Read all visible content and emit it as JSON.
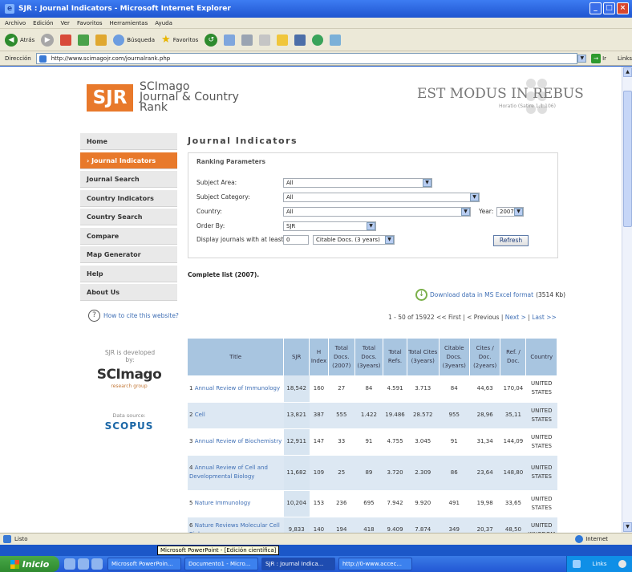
{
  "window": {
    "title": "SJR : Journal Indicators - Microsoft Internet Explorer"
  },
  "menu": [
    "Archivo",
    "Edición",
    "Ver",
    "Favoritos",
    "Herramientas",
    "Ayuda"
  ],
  "toolbar": {
    "back": "Atrás",
    "search": "Búsqueda",
    "favorites": "Favoritos"
  },
  "address": {
    "label": "Dirección",
    "url": "http://www.scimagojr.com/journalrank.php",
    "go_label": "Ir",
    "links": "Links"
  },
  "site": {
    "logo": "SJR",
    "logo_text": [
      "SCImago",
      "Journal & Country",
      "Rank"
    ],
    "motto": "EST MODUS IN REBUS",
    "motto_sub": "Horatio (Satire 1,1,106)"
  },
  "nav": [
    "Home",
    "› Journal Indicators",
    "Journal Search",
    "Country Indicators",
    "Country Search",
    "Compare",
    "Map Generator",
    "Help",
    "About Us"
  ],
  "cite_link": "How to cite this website?",
  "developed_by": "SJR is developed by:",
  "scimago_logo": "SCImago",
  "research_group": "research group",
  "data_source": "Data source:",
  "scopus": "SCOPUS",
  "page": {
    "heading": "Journal Indicators"
  },
  "params": {
    "title": "Ranking Parameters",
    "subject_area_label": "Subject Area:",
    "subject_area": "All",
    "subject_category_label": "Subject Category:",
    "subject_category": "All",
    "country_label": "Country:",
    "country": "All",
    "year_label": "Year:",
    "year": "2007",
    "order_by_label": "Order By:",
    "order_by": "SJR",
    "display_label": "Display journals with at least:",
    "display_value": "0",
    "citable_select": "Citable Docs. (3 years)",
    "refresh": "Refresh"
  },
  "complete_list": "Complete list (2007).",
  "excel_link": "Download data in MS Excel format",
  "excel_size": "(3514 Kb)",
  "pager": {
    "range": "1 - 50 of 15922",
    "first": "<< First",
    "prev": "< Previous",
    "next": "Next >",
    "last": "Last >>"
  },
  "table": {
    "headers": [
      "Title",
      "SJR",
      "H Index",
      "Total Docs. (2007)",
      "Total Docs. (3years)",
      "Total Refs.",
      "Total Cites (3years)",
      "Citable Docs. (3years)",
      "Cites / Doc. (2years)",
      "Ref. / Doc.",
      "Country"
    ],
    "rows": [
      {
        "rank": "1",
        "title": "Annual Review of Immunology",
        "sjr": "18,542",
        "h": "160",
        "d2007": "27",
        "d3": "84",
        "refs": "4.591",
        "cites": "3.713",
        "citable": "84",
        "cpd": "44,63",
        "rpd": "170,04",
        "country": "UNITED STATES"
      },
      {
        "rank": "2",
        "title": "Cell",
        "sjr": "13,821",
        "h": "387",
        "d2007": "555",
        "d3": "1.422",
        "refs": "19.486",
        "cites": "28.572",
        "citable": "955",
        "cpd": "28,96",
        "rpd": "35,11",
        "country": "UNITED STATES"
      },
      {
        "rank": "3",
        "title": "Annual Review of Biochemistry",
        "sjr": "12,911",
        "h": "147",
        "d2007": "33",
        "d3": "91",
        "refs": "4.755",
        "cites": "3.045",
        "citable": "91",
        "cpd": "31,34",
        "rpd": "144,09",
        "country": "UNITED STATES"
      },
      {
        "rank": "4",
        "title": "Annual Review of Cell and Developmental Biology",
        "sjr": "11,682",
        "h": "109",
        "d2007": "25",
        "d3": "89",
        "refs": "3.720",
        "cites": "2.309",
        "citable": "86",
        "cpd": "23,64",
        "rpd": "148,80",
        "country": "UNITED STATES"
      },
      {
        "rank": "5",
        "title": "Nature Immunology",
        "sjr": "10,204",
        "h": "153",
        "d2007": "236",
        "d3": "695",
        "refs": "7.942",
        "cites": "9.920",
        "citable": "491",
        "cpd": "19,98",
        "rpd": "33,65",
        "country": "UNITED STATES"
      },
      {
        "rank": "6",
        "title": "Nature Reviews Molecular Cell Biology",
        "sjr": "9,833",
        "h": "140",
        "d2007": "194",
        "d3": "418",
        "refs": "9.409",
        "cites": "7.874",
        "citable": "349",
        "cpd": "20,37",
        "rpd": "48,50",
        "country": "UNITED KINGDOM"
      }
    ]
  },
  "status": {
    "left": "Listo",
    "zone": "Internet"
  },
  "tooltip": "Microsoft PowerPoint - [Edición científica]",
  "taskbar": {
    "start": "Inicio",
    "tasks": [
      "Microsoft PowerPoin...",
      "Documento1 - Micro...",
      "SJR : Journal Indica...",
      "http://0-www.accec..."
    ],
    "tray_text": "Links"
  },
  "colors": {
    "accent": "#e8792b",
    "header_blue": "#a8c5e0",
    "link": "#3f6fb5"
  }
}
